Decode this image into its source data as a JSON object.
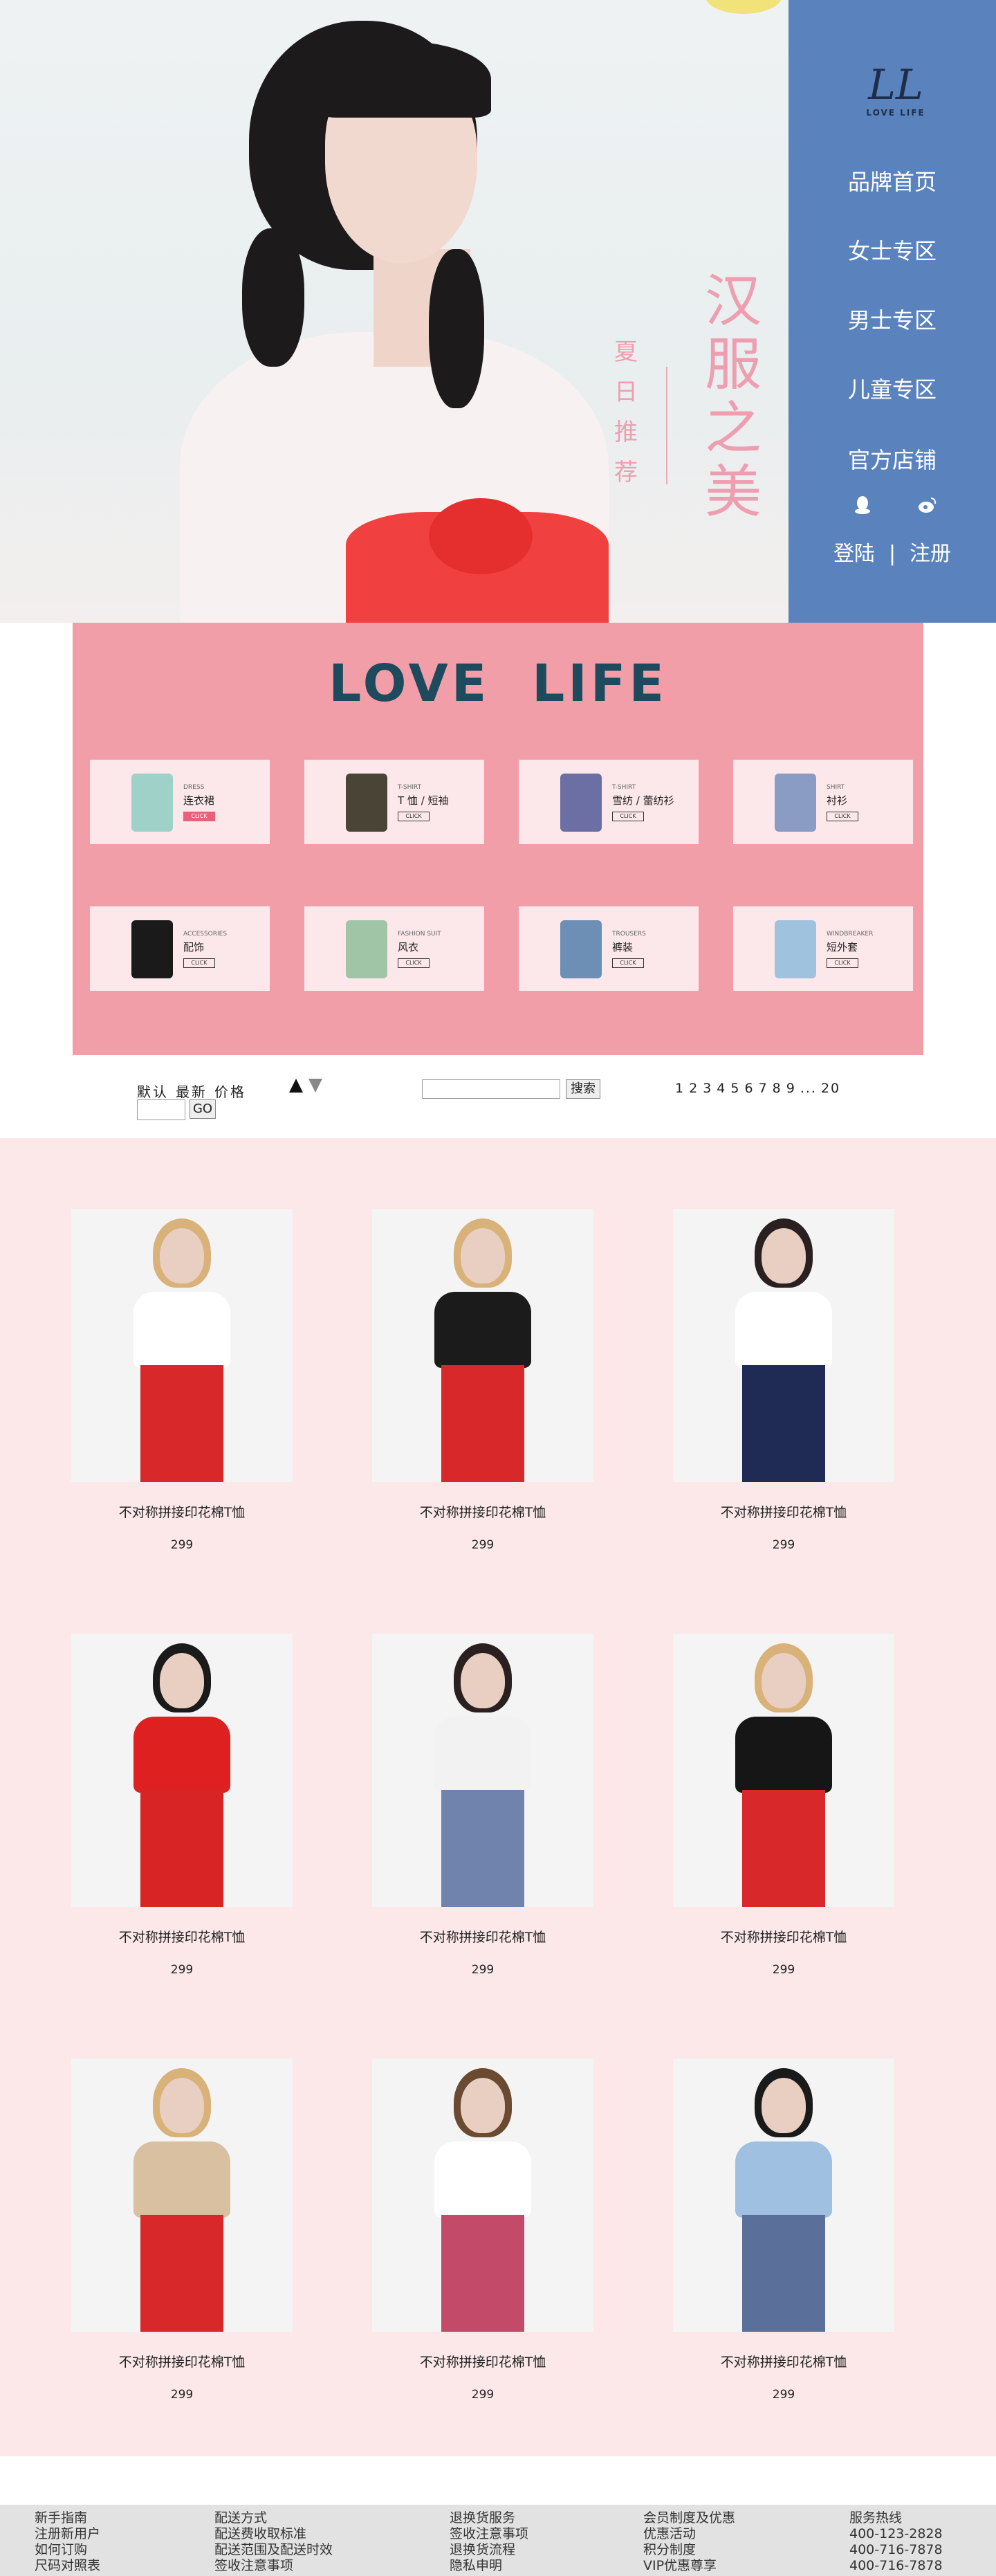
{
  "hero": {
    "title": "汉服之美",
    "subtitle": "夏日推荐"
  },
  "nav": {
    "logo_mark": "LL",
    "logo_word": "LOVE LIFE",
    "items": [
      "品牌首页",
      "女士专区",
      "男士专区",
      "儿童专区",
      "官方店铺"
    ],
    "login": "登陆",
    "separator": "|",
    "register": "注册",
    "social_icons": [
      "qq-icon",
      "weibo-icon"
    ]
  },
  "brand": {
    "title": "LOVE LIFE",
    "accent_color": "#f29ea8",
    "nav_color": "#5a83bd"
  },
  "categories": [
    {
      "en": "DRESS",
      "cn": "连衣裙",
      "button": "CLICK",
      "active": true,
      "color": "#9ed2c9"
    },
    {
      "en": "T-SHIRT",
      "cn": "T 恤 / 短袖",
      "button": "CLICK",
      "active": false,
      "color": "#4a4436"
    },
    {
      "en": "T-SHIRT",
      "cn": "雪纺 / 蕾纺衫",
      "button": "CLICK",
      "active": false,
      "color": "#6b6fa3"
    },
    {
      "en": "SHIRT",
      "cn": "衬衫",
      "button": "CLICK",
      "active": false,
      "color": "#8a9cc4"
    },
    {
      "en": "ACCESSORIES",
      "cn": "配饰",
      "button": "CLICK",
      "active": false,
      "color": "#1a1a1a"
    },
    {
      "en": "FASHION SUIT",
      "cn": "风衣",
      "button": "CLICK",
      "active": false,
      "color": "#9fc4a6"
    },
    {
      "en": "TROUSERS",
      "cn": "裤装",
      "button": "CLICK",
      "active": false,
      "color": "#6d8fb5"
    },
    {
      "en": "WINDBREAKER",
      "cn": "短外套",
      "button": "CLICK",
      "active": false,
      "color": "#9fc3df"
    }
  ],
  "toolbar": {
    "sort_options": [
      "默认",
      "最新",
      "价格"
    ],
    "go_label": "GO",
    "page_input_value": "",
    "search_value": "",
    "search_button": "搜索",
    "pages": [
      "1",
      "2",
      "3",
      "4",
      "5",
      "6",
      "7",
      "8",
      "9",
      "...",
      "20"
    ]
  },
  "products": [
    {
      "name": "不对称拼接印花棉T恤",
      "price": "299",
      "hair": "#d9b27a",
      "top": "#ffffff",
      "bottom": "#d8282a"
    },
    {
      "name": "不对称拼接印花棉T恤",
      "price": "299",
      "hair": "#d9b27a",
      "top": "#1b1b1b",
      "bottom": "#d8282a"
    },
    {
      "name": "不对称拼接印花棉T恤",
      "price": "299",
      "hair": "#2a2020",
      "top": "#ffffff",
      "bottom": "#1f2a55"
    },
    {
      "name": "不对称拼接印花棉T恤",
      "price": "299",
      "hair": "#1a1a1a",
      "top": "#de2020",
      "bottom": "#d82424"
    },
    {
      "name": "不对称拼接印花棉T恤",
      "price": "299",
      "hair": "#2a2020",
      "top": "#f2f2f2",
      "bottom": "#6f83ad"
    },
    {
      "name": "不对称拼接印花棉T恤",
      "price": "299",
      "hair": "#d9b27a",
      "top": "#161616",
      "bottom": "#d8282a"
    },
    {
      "name": "不对称拼接印花棉T恤",
      "price": "299",
      "hair": "#d9b27a",
      "top": "#d8c0a0",
      "bottom": "#d8282a"
    },
    {
      "name": "不对称拼接印花棉T恤",
      "price": "299",
      "hair": "#6a4a30",
      "top": "#ffffff",
      "bottom": "#c44a6a"
    },
    {
      "name": "不对称拼接印花棉T恤",
      "price": "299",
      "hair": "#1a1a1a",
      "top": "#9fc0e0",
      "bottom": "#5a6f9a"
    }
  ],
  "footer": {
    "columns": [
      [
        "新手指南",
        "注册新用户",
        "如何订购",
        "尺码对照表"
      ],
      [
        "配送方式",
        "配送费收取标准",
        "配送范围及配送时效",
        "签收注意事项"
      ],
      [
        "退换货服务",
        "签收注意事项",
        "退换货流程",
        "隐私申明"
      ],
      [
        "会员制度及优惠",
        "优惠活动",
        "积分制度",
        "VIP优惠尊享"
      ],
      [
        "服务热线",
        "400-123-2828",
        "400-716-7878",
        "400-716-7878"
      ]
    ]
  }
}
